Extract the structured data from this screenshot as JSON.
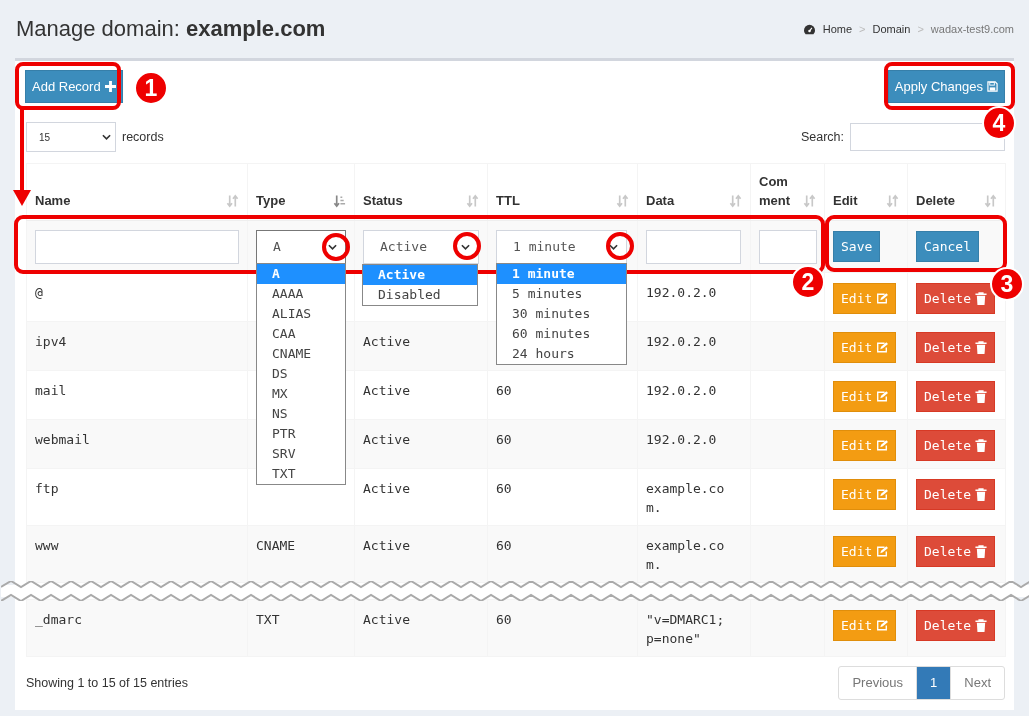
{
  "page": {
    "title_prefix": "Manage domain: ",
    "title_domain": "example.com"
  },
  "breadcrumb": [
    {
      "label": "Home",
      "kind": "home"
    },
    {
      "label": "Domain",
      "kind": "link"
    },
    {
      "label": "wadax-test9.com",
      "kind": "current"
    }
  ],
  "breadcrumb_separator": ">",
  "add_button": "Add Record",
  "apply_button": "Apply Changes",
  "length": {
    "value": "15",
    "label": "records"
  },
  "search": {
    "label": "Search:"
  },
  "columns": [
    {
      "label": "Name",
      "sorted": false
    },
    {
      "label": "Type",
      "sorted": true
    },
    {
      "label": "Status",
      "sorted": false
    },
    {
      "label": "TTL",
      "sorted": false
    },
    {
      "label": "Data",
      "sorted": false
    },
    {
      "label": "Comment",
      "sorted": false
    },
    {
      "label": "Edit",
      "sorted": false
    },
    {
      "label": "Delete",
      "sorted": false
    }
  ],
  "new_row": {
    "type": {
      "value": "A",
      "options": [
        {
          "label": "A",
          "selected": true
        },
        {
          "label": "AAAA",
          "selected": false
        },
        {
          "label": "ALIAS",
          "selected": false
        },
        {
          "label": "CAA",
          "selected": false
        },
        {
          "label": "CNAME",
          "selected": false
        },
        {
          "label": "DS",
          "selected": false
        },
        {
          "label": "MX",
          "selected": false
        },
        {
          "label": "NS",
          "selected": false
        },
        {
          "label": "PTR",
          "selected": false
        },
        {
          "label": "SRV",
          "selected": false
        },
        {
          "label": "TXT",
          "selected": false
        }
      ]
    },
    "status": {
      "value": "Active",
      "options": [
        {
          "label": "Active",
          "selected": true
        },
        {
          "label": "Disabled",
          "selected": false
        }
      ]
    },
    "ttl": {
      "value": "1 minute",
      "options": [
        {
          "label": "1 minute",
          "selected": true
        },
        {
          "label": "5 minutes",
          "selected": false
        },
        {
          "label": "30 minutes",
          "selected": false
        },
        {
          "label": "60 minutes",
          "selected": false
        },
        {
          "label": "24 hours",
          "selected": false
        }
      ]
    },
    "save": "Save",
    "cancel": "Cancel"
  },
  "rows": [
    {
      "name": "@",
      "data": "192.0.2.0",
      "edit": "Edit",
      "delete": "Delete",
      "after_break": false
    },
    {
      "name": "ipv4",
      "status": "Active",
      "data": "192.0.2.0",
      "edit": "Edit",
      "delete": "Delete",
      "after_break": false
    },
    {
      "name": "mail",
      "status": "Active",
      "ttl": "60",
      "data": "192.0.2.0",
      "edit": "Edit",
      "delete": "Delete",
      "after_break": false
    },
    {
      "name": "webmail",
      "status": "Active",
      "ttl": "60",
      "data": "192.0.2.0",
      "edit": "Edit",
      "delete": "Delete",
      "after_break": false
    },
    {
      "name": "ftp",
      "status": "Active",
      "ttl": "60",
      "data": "example.com.",
      "edit": "Edit",
      "delete": "Delete",
      "after_break": false
    },
    {
      "name": "www",
      "type": "CNAME",
      "status": "Active",
      "ttl": "60",
      "data": "example.com.",
      "edit": "Edit",
      "delete": "Delete",
      "after_break": false
    },
    {
      "name": "_dmarc",
      "type": "TXT",
      "status": "Active",
      "ttl": "60",
      "data": "\"v=DMARC1; p=none\"",
      "edit": "Edit",
      "delete": "Delete",
      "after_break": true
    }
  ],
  "footer": {
    "info": "Showing 1 to 15 of 15 entries",
    "pages": [
      {
        "label": "Previous",
        "selected": false,
        "disabled": true
      },
      {
        "label": "1",
        "selected": true,
        "disabled": false
      },
      {
        "label": "Next",
        "selected": false,
        "disabled": true
      }
    ]
  },
  "annotations": {
    "badges": [
      "1",
      "2",
      "3",
      "4"
    ]
  }
}
